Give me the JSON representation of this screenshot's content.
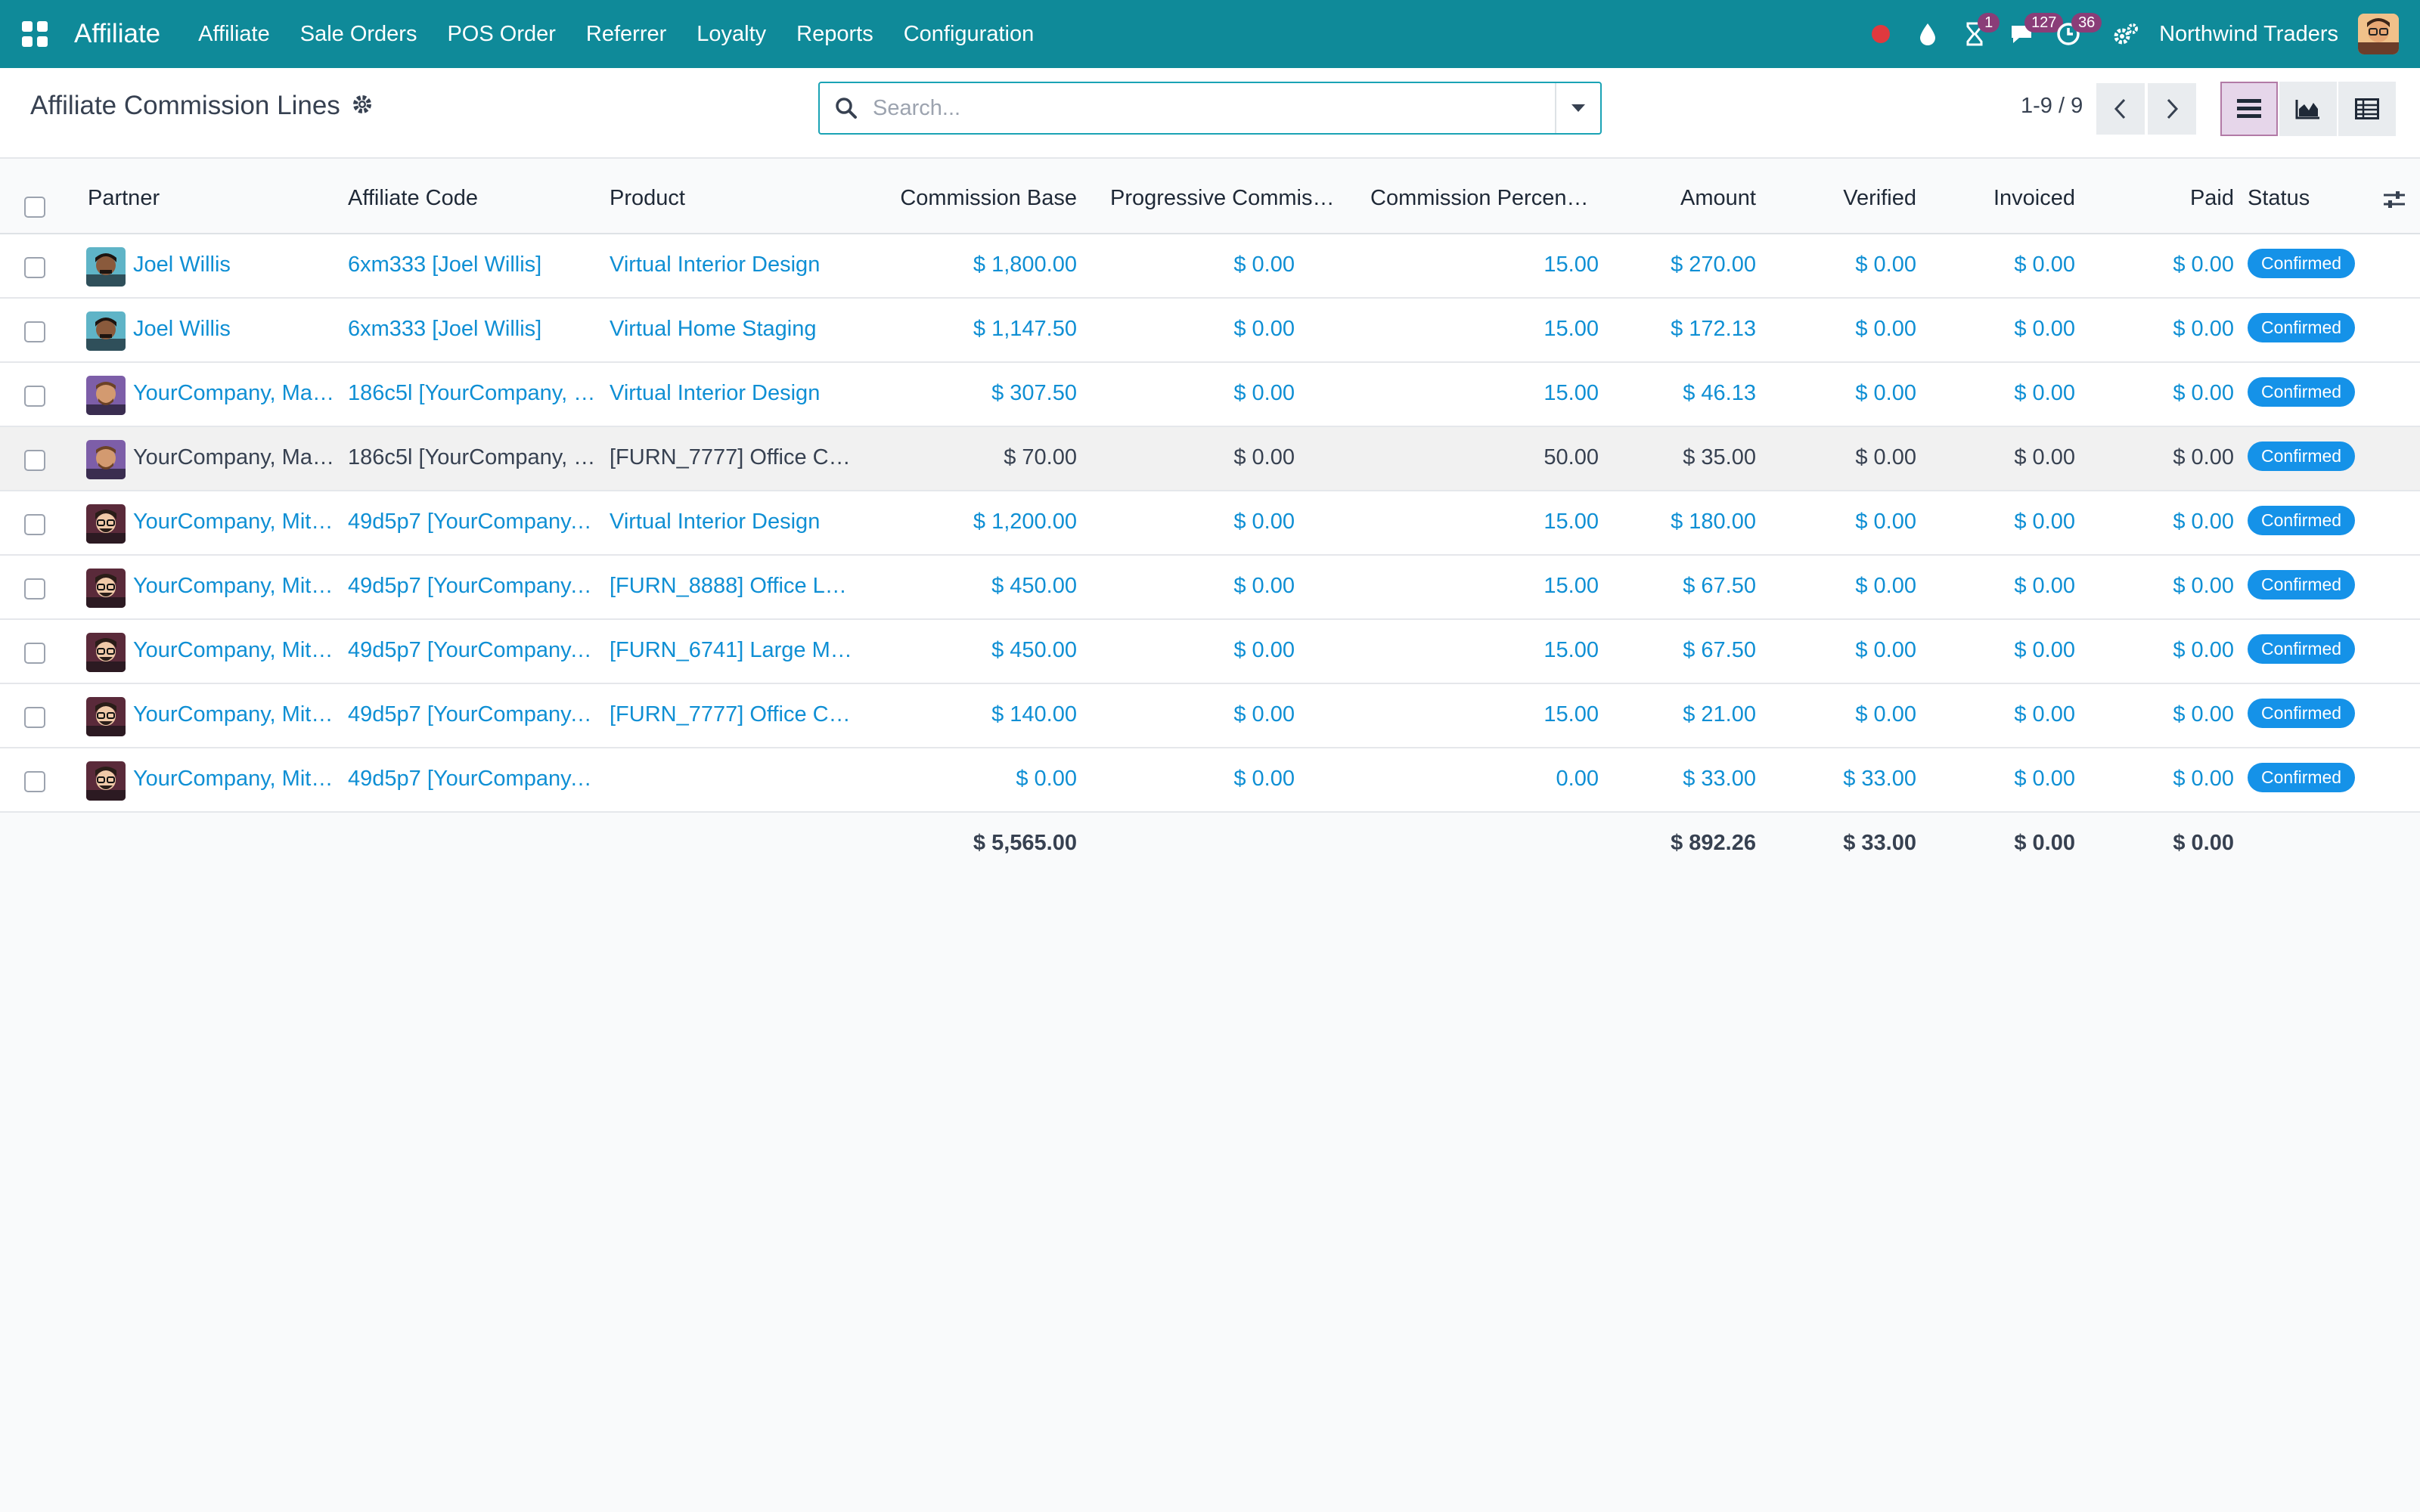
{
  "navbar": {
    "brand": "Affiliate",
    "menu": [
      "Affiliate",
      "Sale Orders",
      "POS Order",
      "Referrer",
      "Loyalty",
      "Reports",
      "Configuration"
    ],
    "activity_badge": "1",
    "messages_badge": "127",
    "clock_badge": "36",
    "company": "Northwind Traders",
    "bg_color": "#0f8a99"
  },
  "control": {
    "title": "Affiliate Commission Lines",
    "search_placeholder": "Search...",
    "pager": "1-9 / 9"
  },
  "table": {
    "headers": {
      "partner": "Partner",
      "code": "Affiliate Code",
      "product": "Product",
      "base": "Commission Base",
      "progressive": "Progressive Commis…",
      "percent": "Commission Percen…",
      "amount": "Amount",
      "verified": "Verified",
      "invoiced": "Invoiced",
      "paid": "Paid",
      "status": "Status"
    },
    "rows": [
      {
        "partner": "Joel Willis",
        "avatar": "joel",
        "code": "6xm333 [Joel Willis]",
        "product": "Virtual Interior Design",
        "base": "$ 1,800.00",
        "progressive": "$ 0.00",
        "percent": "15.00",
        "amount": "$ 270.00",
        "verified": "$ 0.00",
        "invoiced": "$ 0.00",
        "paid": "$ 0.00",
        "status": "Confirmed",
        "muted": false
      },
      {
        "partner": "Joel Willis",
        "avatar": "joel",
        "code": "6xm333 [Joel Willis]",
        "product": "Virtual Home Staging",
        "base": "$ 1,147.50",
        "progressive": "$ 0.00",
        "percent": "15.00",
        "amount": "$ 172.13",
        "verified": "$ 0.00",
        "invoiced": "$ 0.00",
        "paid": "$ 0.00",
        "status": "Confirmed",
        "muted": false
      },
      {
        "partner": "YourCompany, Ma…",
        "avatar": "marc",
        "code": "186c5l [YourCompany, …",
        "product": "Virtual Interior Design",
        "base": "$ 307.50",
        "progressive": "$ 0.00",
        "percent": "15.00",
        "amount": "$ 46.13",
        "verified": "$ 0.00",
        "invoiced": "$ 0.00",
        "paid": "$ 0.00",
        "status": "Confirmed",
        "muted": false
      },
      {
        "partner": "YourCompany, Ma…",
        "avatar": "marc",
        "code": "186c5l [YourCompany, …",
        "product": "[FURN_7777] Office Ch…",
        "base": "$ 70.00",
        "progressive": "$ 0.00",
        "percent": "50.00",
        "amount": "$ 35.00",
        "verified": "$ 0.00",
        "invoiced": "$ 0.00",
        "paid": "$ 0.00",
        "status": "Confirmed",
        "muted": true
      },
      {
        "partner": "YourCompany, Mit…",
        "avatar": "mitchell",
        "code": "49d5p7 [YourCompany,…",
        "product": "Virtual Interior Design",
        "base": "$ 1,200.00",
        "progressive": "$ 0.00",
        "percent": "15.00",
        "amount": "$ 180.00",
        "verified": "$ 0.00",
        "invoiced": "$ 0.00",
        "paid": "$ 0.00",
        "status": "Confirmed",
        "muted": false
      },
      {
        "partner": "YourCompany, Mit…",
        "avatar": "mitchell",
        "code": "49d5p7 [YourCompany,…",
        "product": "[FURN_8888] Office La…",
        "base": "$ 450.00",
        "progressive": "$ 0.00",
        "percent": "15.00",
        "amount": "$ 67.50",
        "verified": "$ 0.00",
        "invoiced": "$ 0.00",
        "paid": "$ 0.00",
        "status": "Confirmed",
        "muted": false
      },
      {
        "partner": "YourCompany, Mit…",
        "avatar": "mitchell",
        "code": "49d5p7 [YourCompany,…",
        "product": "[FURN_6741] Large Me…",
        "base": "$ 450.00",
        "progressive": "$ 0.00",
        "percent": "15.00",
        "amount": "$ 67.50",
        "verified": "$ 0.00",
        "invoiced": "$ 0.00",
        "paid": "$ 0.00",
        "status": "Confirmed",
        "muted": false
      },
      {
        "partner": "YourCompany, Mit…",
        "avatar": "mitchell",
        "code": "49d5p7 [YourCompany,…",
        "product": "[FURN_7777] Office Ch…",
        "base": "$ 140.00",
        "progressive": "$ 0.00",
        "percent": "15.00",
        "amount": "$ 21.00",
        "verified": "$ 0.00",
        "invoiced": "$ 0.00",
        "paid": "$ 0.00",
        "status": "Confirmed",
        "muted": false
      },
      {
        "partner": "YourCompany, Mit…",
        "avatar": "mitchell",
        "code": "49d5p7 [YourCompany,…",
        "product": "",
        "base": "$ 0.00",
        "progressive": "$ 0.00",
        "percent": "0.00",
        "amount": "$ 33.00",
        "verified": "$ 33.00",
        "invoiced": "$ 0.00",
        "paid": "$ 0.00",
        "status": "Confirmed",
        "muted": false
      }
    ],
    "totals": {
      "base": "$ 5,565.00",
      "amount": "$ 892.26",
      "verified": "$ 33.00",
      "invoiced": "$ 0.00",
      "paid": "$ 0.00"
    }
  }
}
